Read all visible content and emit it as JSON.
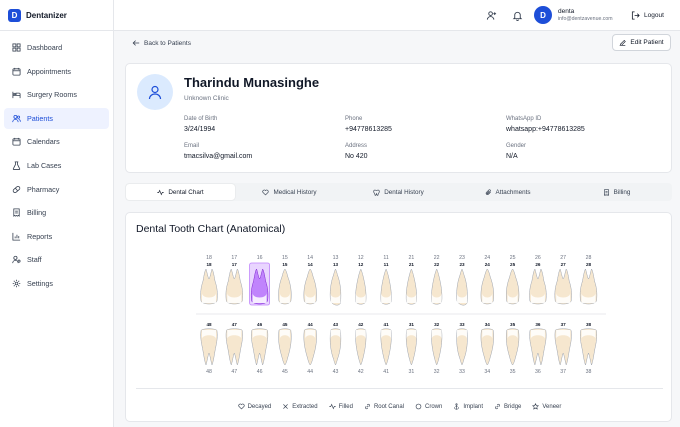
{
  "app": {
    "name": "Dentanizer",
    "logo_letter": "D"
  },
  "sidebar": {
    "items": [
      {
        "label": "Dashboard",
        "icon": "grid-icon"
      },
      {
        "label": "Appointments",
        "icon": "calendar-icon"
      },
      {
        "label": "Surgery Rooms",
        "icon": "bed-icon"
      },
      {
        "label": "Patients",
        "icon": "users-icon",
        "active": true
      },
      {
        "label": "Calendars",
        "icon": "calendar-icon"
      },
      {
        "label": "Lab Cases",
        "icon": "flask-icon"
      },
      {
        "label": "Pharmacy",
        "icon": "pill-icon"
      },
      {
        "label": "Billing",
        "icon": "receipt-icon"
      },
      {
        "label": "Reports",
        "icon": "chart-icon"
      },
      {
        "label": "Staff",
        "icon": "staff-icon"
      },
      {
        "label": "Settings",
        "icon": "gear-icon"
      }
    ]
  },
  "header": {
    "user_name": "denta",
    "user_email": "info@dentzavenue.com",
    "avatar_letter": "D",
    "logout_label": "Logout"
  },
  "page": {
    "back_label": "Back to Patients",
    "edit_label": "Edit Patient"
  },
  "patient": {
    "name": "Tharindu Munasinghe",
    "clinic": "Unknown Clinic",
    "fields": [
      {
        "label": "Date of Birth",
        "value": "3/24/1994"
      },
      {
        "label": "Phone",
        "value": "+94778613285"
      },
      {
        "label": "WhatsApp ID",
        "value": "whatsapp:+94778613285"
      },
      {
        "label": "Email",
        "value": "tmacsilva@gmail.com"
      },
      {
        "label": "Address",
        "value": "No 420"
      },
      {
        "label": "Gender",
        "value": "N/A"
      }
    ]
  },
  "tabs": [
    {
      "label": "Dental Chart",
      "icon": "pulse-icon",
      "active": true
    },
    {
      "label": "Medical History",
      "icon": "heart-icon"
    },
    {
      "label": "Dental History",
      "icon": "tooth-icon"
    },
    {
      "label": "Attachments",
      "icon": "paperclip-icon"
    },
    {
      "label": "Billing",
      "icon": "receipt-icon"
    }
  ],
  "chart": {
    "title": "Dental Tooth Chart (Anatomical)",
    "upper_outer_labels": [
      "18",
      "17",
      "16",
      "15",
      "14",
      "13",
      "12",
      "11",
      "21",
      "22",
      "23",
      "24",
      "25",
      "26",
      "27",
      "28"
    ],
    "upper_inner_labels": [
      "18",
      "17",
      "16",
      "15",
      "14",
      "13",
      "12",
      "11",
      "21",
      "22",
      "23",
      "24",
      "25",
      "26",
      "27",
      "28"
    ],
    "upper_types": [
      "molar",
      "molar",
      "molar",
      "premolar",
      "premolar",
      "canine",
      "incisor",
      "incisor",
      "incisor",
      "incisor",
      "canine",
      "premolar",
      "premolar",
      "molar",
      "molar",
      "molar"
    ],
    "lower_outer_labels": [
      "48",
      "47",
      "46",
      "45",
      "44",
      "43",
      "42",
      "41",
      "31",
      "32",
      "33",
      "34",
      "35",
      "36",
      "37",
      "38"
    ],
    "lower_inner_labels": [
      "48",
      "47",
      "46",
      "45",
      "44",
      "43",
      "42",
      "41",
      "31",
      "32",
      "33",
      "34",
      "35",
      "36",
      "37",
      "38"
    ],
    "lower_types": [
      "molar",
      "molar",
      "molar",
      "premolar",
      "premolar",
      "canine",
      "incisor",
      "incisor",
      "incisor",
      "incisor",
      "canine",
      "premolar",
      "premolar",
      "molar",
      "molar",
      "molar"
    ],
    "selected_tooth": "16",
    "colors": {
      "tooth_fill": "#f6e7cf",
      "tooth_stroke": "#9ca3af",
      "crown_fill": "#ffffff",
      "selected_fill": "#c084fc",
      "selected_bg": "#e9d5ff"
    }
  },
  "legend": [
    {
      "label": "Decayed",
      "icon": "heart-outline-icon"
    },
    {
      "label": "Extracted",
      "icon": "x-icon"
    },
    {
      "label": "Filled",
      "icon": "pulse-icon"
    },
    {
      "label": "Root Canal",
      "icon": "link-icon"
    },
    {
      "label": "Crown",
      "icon": "circle-icon"
    },
    {
      "label": "Implant",
      "icon": "anchor-icon"
    },
    {
      "label": "Bridge",
      "icon": "link-icon"
    },
    {
      "label": "Veneer",
      "icon": "star-icon"
    }
  ]
}
